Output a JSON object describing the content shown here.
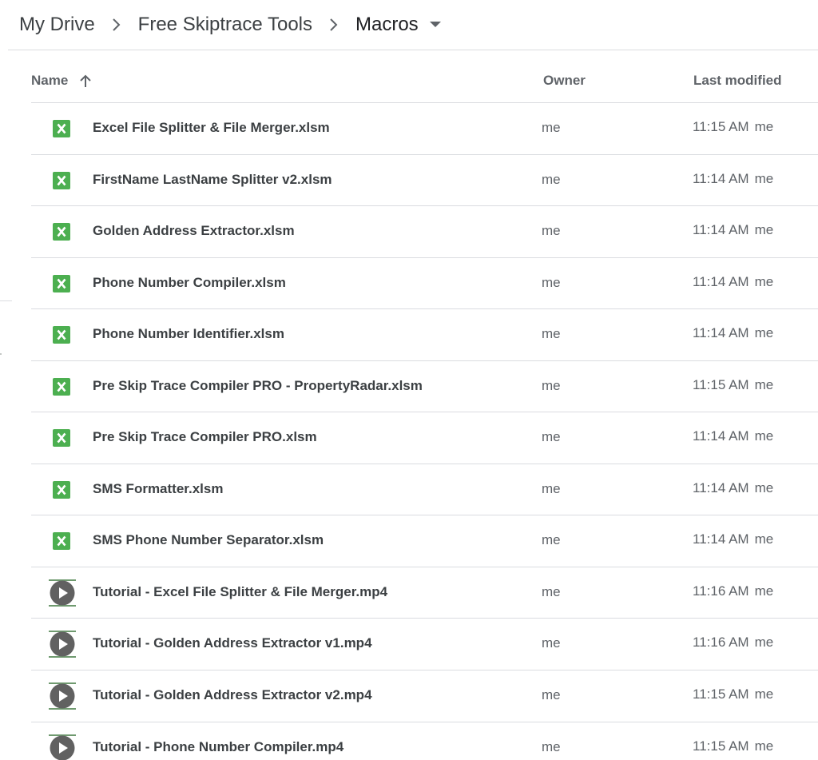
{
  "breadcrumb": {
    "items": [
      "My Drive",
      "Free Skiptrace Tools",
      "Macros"
    ]
  },
  "columns": {
    "name": "Name",
    "owner": "Owner",
    "last_modified": "Last modified"
  },
  "colors": {
    "excel_green": "#4caf50",
    "video_grey": "#5f6368",
    "text_primary": "#3c4043",
    "text_secondary": "#5f6368",
    "divider": "#dadce0"
  },
  "files": [
    {
      "name": "Excel File Splitter & File Merger.xlsm",
      "type": "excel-icon",
      "owner": "me",
      "time": "11:15 AM",
      "by": "me"
    },
    {
      "name": "FirstName LastName Splitter v2.xlsm",
      "type": "excel-icon",
      "owner": "me",
      "time": "11:14 AM",
      "by": "me"
    },
    {
      "name": "Golden Address Extractor.xlsm",
      "type": "excel-icon",
      "owner": "me",
      "time": "11:14 AM",
      "by": "me"
    },
    {
      "name": "Phone Number Compiler.xlsm",
      "type": "excel-icon",
      "owner": "me",
      "time": "11:14 AM",
      "by": "me"
    },
    {
      "name": "Phone Number Identifier.xlsm",
      "type": "excel-icon",
      "owner": "me",
      "time": "11:14 AM",
      "by": "me"
    },
    {
      "name": "Pre Skip Trace Compiler PRO - PropertyRadar.xlsm",
      "type": "excel-icon",
      "owner": "me",
      "time": "11:15 AM",
      "by": "me"
    },
    {
      "name": "Pre Skip Trace Compiler PRO.xlsm",
      "type": "excel-icon",
      "owner": "me",
      "time": "11:14 AM",
      "by": "me"
    },
    {
      "name": "SMS Formatter.xlsm",
      "type": "excel-icon",
      "owner": "me",
      "time": "11:14 AM",
      "by": "me"
    },
    {
      "name": "SMS Phone Number Separator.xlsm",
      "type": "excel-icon",
      "owner": "me",
      "time": "11:14 AM",
      "by": "me"
    },
    {
      "name": "Tutorial - Excel File Splitter & File Merger.mp4",
      "type": "video-icon",
      "owner": "me",
      "time": "11:16 AM",
      "by": "me"
    },
    {
      "name": "Tutorial - Golden Address Extractor v1.mp4",
      "type": "video-icon",
      "owner": "me",
      "time": "11:16 AM",
      "by": "me"
    },
    {
      "name": "Tutorial - Golden Address Extractor v2.mp4",
      "type": "video-icon",
      "owner": "me",
      "time": "11:15 AM",
      "by": "me"
    },
    {
      "name": "Tutorial - Phone Number Compiler.mp4",
      "type": "video-icon",
      "owner": "me",
      "time": "11:15 AM",
      "by": "me"
    }
  ]
}
